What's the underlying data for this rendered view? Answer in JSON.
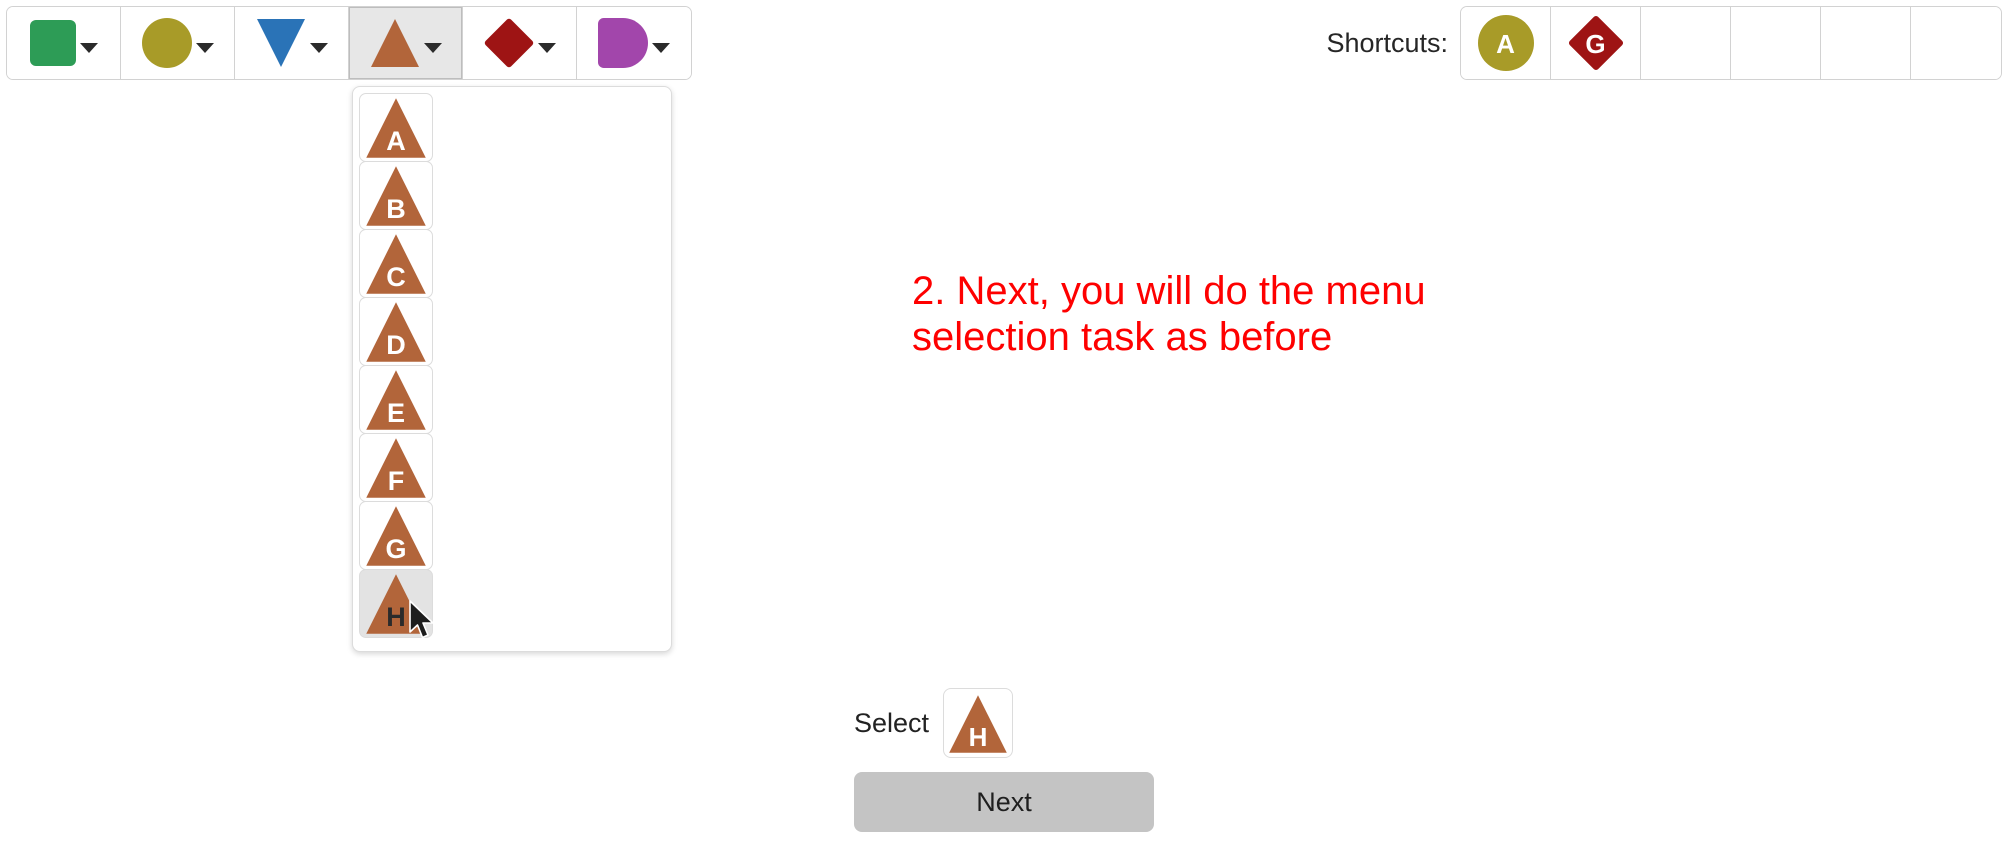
{
  "app": {
    "background": "#ffffff"
  },
  "toolbar": {
    "name": "shape-toolbar",
    "items": [
      {
        "id": "square",
        "shape": "square",
        "color": "#2d9c56",
        "label": "Green square menu",
        "active": false,
        "caret": "chevron-down-icon"
      },
      {
        "id": "circle",
        "shape": "circle",
        "color": "#a89b28",
        "label": "Olive circle menu",
        "active": false,
        "caret": "chevron-down-icon"
      },
      {
        "id": "triangle-down",
        "shape": "triangle-down",
        "color": "#2a73b7",
        "label": "Blue down triangle menu",
        "active": false,
        "caret": "chevron-down-icon"
      },
      {
        "id": "triangle-up",
        "shape": "triangle-up",
        "color": "#b2653a",
        "label": "Brown up triangle menu",
        "active": true,
        "caret": "chevron-down-icon"
      },
      {
        "id": "diamond",
        "shape": "diamond",
        "color": "#9e1414",
        "label": "Dark red diamond menu",
        "active": false,
        "caret": "chevron-down-icon"
      },
      {
        "id": "dshape",
        "shape": "dshape",
        "color": "#a246ab",
        "label": "Purple D shape menu",
        "active": false,
        "caret": "chevron-down-icon"
      }
    ]
  },
  "menu": {
    "name": "triangle-dropdown-menu",
    "open_for": "triangle-up",
    "shape": "triangle-up",
    "color": "#b2653a",
    "items": [
      {
        "letter": "A",
        "hovered": false
      },
      {
        "letter": "B",
        "hovered": false
      },
      {
        "letter": "C",
        "hovered": false
      },
      {
        "letter": "D",
        "hovered": false
      },
      {
        "letter": "E",
        "hovered": false
      },
      {
        "letter": "F",
        "hovered": false
      },
      {
        "letter": "G",
        "hovered": false
      },
      {
        "letter": "H",
        "hovered": true
      }
    ]
  },
  "shortcuts": {
    "label": "Shortcuts:",
    "cells": [
      {
        "letter": "A",
        "shape": "circle",
        "color": "#a89b28",
        "empty": false
      },
      {
        "letter": "G",
        "shape": "diamond",
        "color": "#9e1414",
        "empty": false
      },
      {
        "letter": "",
        "shape": "",
        "color": "",
        "empty": true
      },
      {
        "letter": "",
        "shape": "",
        "color": "",
        "empty": true
      },
      {
        "letter": "",
        "shape": "",
        "color": "",
        "empty": true
      },
      {
        "letter": "",
        "shape": "",
        "color": "",
        "empty": true
      }
    ]
  },
  "instruction": {
    "text": "2. Next, you will do the menu selection task as before",
    "color": "#fe0000"
  },
  "prompt": {
    "select_label": "Select",
    "target": {
      "letter": "H",
      "shape": "triangle-up",
      "color": "#b2653a"
    }
  },
  "next_button": {
    "label": "Next",
    "background": "#c4c4c4"
  },
  "cursor": {
    "name": "mouse-pointer"
  }
}
